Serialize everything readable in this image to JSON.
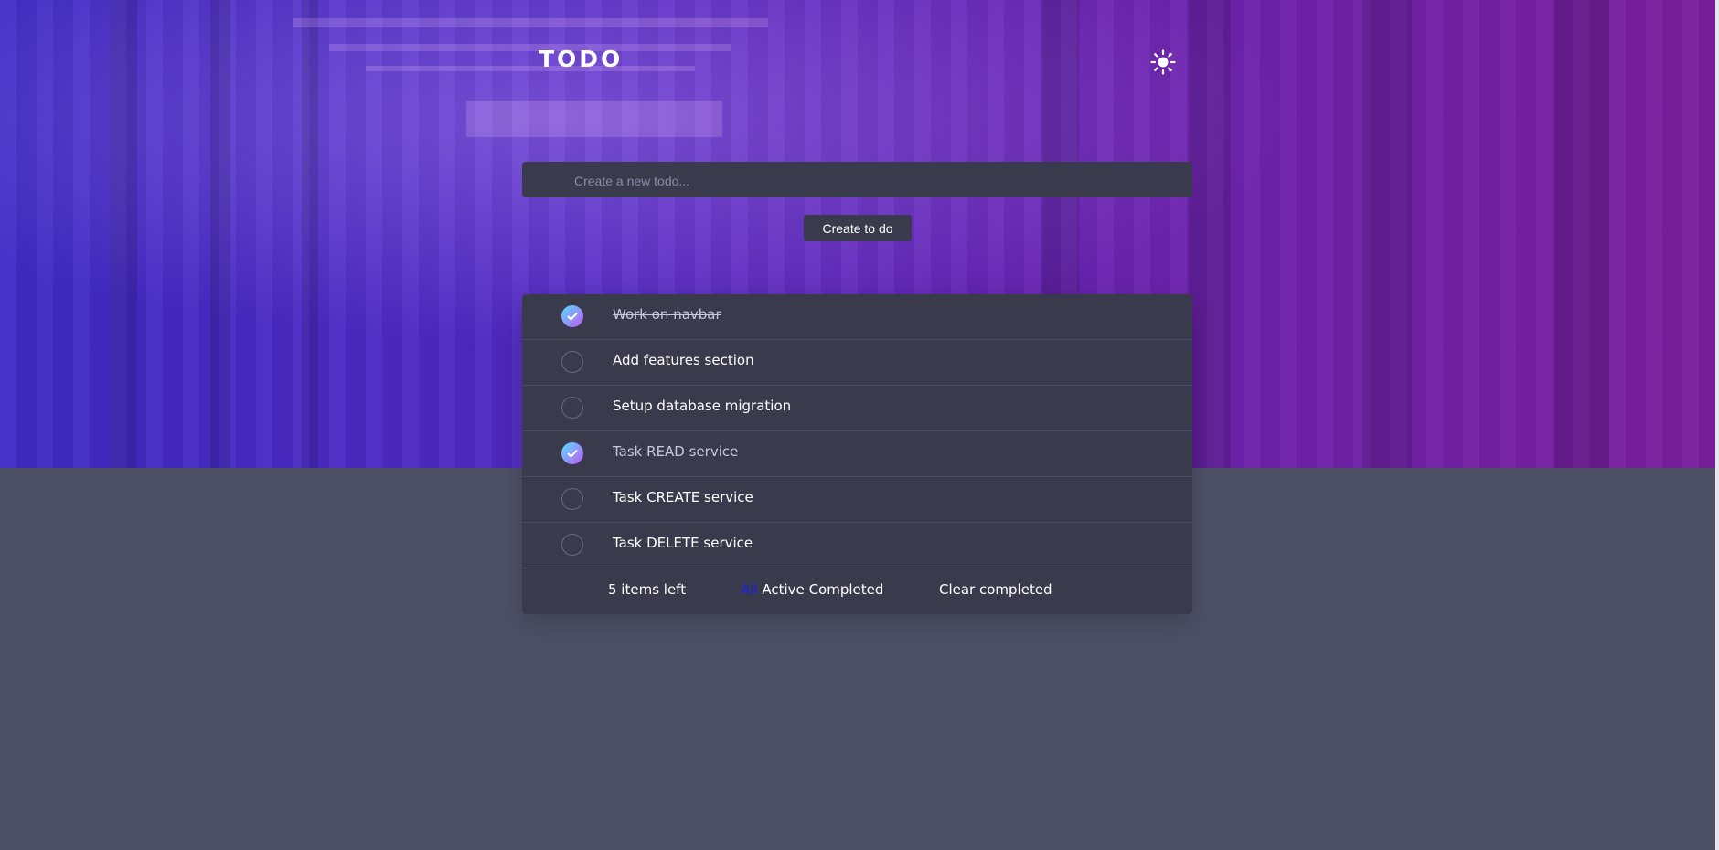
{
  "header": {
    "title": "TODO",
    "theme_icon": "sun-icon"
  },
  "new_todo": {
    "placeholder": "Create a new todo...",
    "value": "",
    "submit_label": "Create to do"
  },
  "todos": [
    {
      "text": "Work on navbar",
      "completed": true
    },
    {
      "text": "Add features section",
      "completed": false
    },
    {
      "text": "Setup database migration",
      "completed": false
    },
    {
      "text": "Task READ service",
      "completed": true
    },
    {
      "text": "Task CREATE service",
      "completed": false
    },
    {
      "text": "Task DELETE service",
      "completed": false
    }
  ],
  "footer": {
    "items_left": "5 items left",
    "filters": {
      "all": "All",
      "active": "Active",
      "completed": "Completed"
    },
    "active_filter": "All",
    "clear_label": "Clear completed"
  },
  "colors": {
    "page_bg": "#4e5166",
    "card_bg": "#393a4c",
    "check_gradient_start": "#57ddff",
    "check_gradient_end": "#c058f3",
    "active_filter": "#1d1df0"
  }
}
